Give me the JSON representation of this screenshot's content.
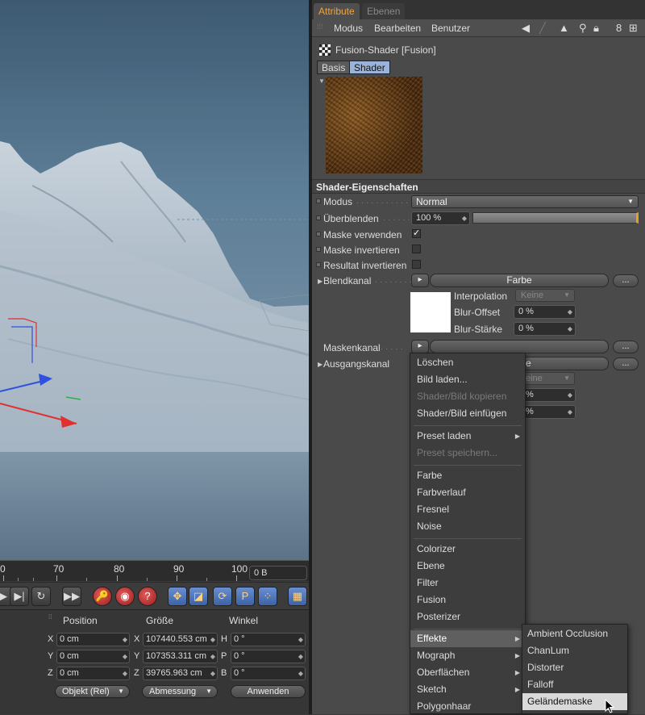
{
  "viewport": {
    "timeline_ticks": [
      "0",
      "70",
      "80",
      "90",
      "100"
    ],
    "frame_field": "0 B"
  },
  "coords": {
    "headers": [
      "Position",
      "Größe",
      "Winkel"
    ],
    "position": [
      {
        "axis": "X",
        "value": "0 cm"
      },
      {
        "axis": "Y",
        "value": "0 cm"
      },
      {
        "axis": "Z",
        "value": "0 cm"
      }
    ],
    "size": [
      {
        "axis": "X",
        "value": "107440.553 cm"
      },
      {
        "axis": "Y",
        "value": "107353.311 cm"
      },
      {
        "axis": "Z",
        "value": "39765.963 cm"
      }
    ],
    "angle": [
      {
        "axis": "H",
        "value": "0 °"
      },
      {
        "axis": "P",
        "value": "0 °"
      },
      {
        "axis": "B",
        "value": "0 °"
      }
    ],
    "mode_dropdown": "Objekt (Rel)",
    "size_dropdown": "Abmessung",
    "apply_button": "Anwenden"
  },
  "attr": {
    "tabs": [
      "Attribute",
      "Ebenen"
    ],
    "menu": [
      "Modus",
      "Bearbeiten",
      "Benutzer"
    ],
    "object_title": "Fusion-Shader [Fusion]",
    "subtabs": [
      "Basis",
      "Shader"
    ],
    "section_title": "Shader-Eigenschaften",
    "props": {
      "modus_label": "Modus",
      "modus_value": "Normal",
      "ueberblenden_label": "Überblenden",
      "ueberblenden_value": "100 %",
      "ueberblenden_fraction": 1.0,
      "maske_verwenden_label": "Maske verwenden",
      "maske_verwenden_checked": "✓",
      "maske_invertieren_label": "Maske invertieren",
      "resultat_invertieren_label": "Resultat invertieren",
      "blendkanal_label": "Blendkanal",
      "blendkanal_button": "Farbe",
      "interpolation_label": "Interpolation",
      "interpolation_value": "Keine",
      "blur_offset_label": "Blur-Offset",
      "blur_offset_value": "0 %",
      "blur_staerke_label": "Blur-Stärke",
      "blur_staerke_value": "0 %",
      "maskenkanal_label": "Maskenkanal",
      "ausgangskanal_label": "Ausgangskanal",
      "ausgangskanal_partial": "e",
      "interpolation2_partial": "eine",
      "percent_partial": "%",
      "dots": "..."
    }
  },
  "context_menu": {
    "items": [
      {
        "label": "Löschen",
        "disabled": false,
        "submenu": false
      },
      {
        "label": "Bild laden...",
        "disabled": false,
        "submenu": false
      },
      {
        "label": "Shader/Bild kopieren",
        "disabled": true,
        "submenu": false
      },
      {
        "label": "Shader/Bild einfügen",
        "disabled": false,
        "submenu": false
      },
      {
        "label": "Preset laden",
        "disabled": false,
        "submenu": true
      },
      {
        "label": "Preset speichern...",
        "disabled": true,
        "submenu": false
      },
      {
        "label": "Farbe",
        "disabled": false,
        "submenu": false
      },
      {
        "label": "Farbverlauf",
        "disabled": false,
        "submenu": false
      },
      {
        "label": "Fresnel",
        "disabled": false,
        "submenu": false
      },
      {
        "label": "Noise",
        "disabled": false,
        "submenu": false
      },
      {
        "label": "Colorizer",
        "disabled": false,
        "submenu": false
      },
      {
        "label": "Ebene",
        "disabled": false,
        "submenu": false
      },
      {
        "label": "Filter",
        "disabled": false,
        "submenu": false
      },
      {
        "label": "Fusion",
        "disabled": false,
        "submenu": false
      },
      {
        "label": "Posterizer",
        "disabled": false,
        "submenu": false
      },
      {
        "label": "Effekte",
        "disabled": false,
        "submenu": true,
        "highlighted": true
      },
      {
        "label": "Mograph",
        "disabled": false,
        "submenu": true
      },
      {
        "label": "Oberflächen",
        "disabled": false,
        "submenu": true
      },
      {
        "label": "Sketch",
        "disabled": false,
        "submenu": true
      },
      {
        "label": "Polygonhaar",
        "disabled": false,
        "submenu": false
      }
    ],
    "submenu_items": [
      "Ambient Occlusion",
      "ChanLum",
      "Distorter",
      "Falloff",
      "Geländemaske"
    ],
    "submenu_selected": "Geländemaske"
  },
  "colors": {
    "accent_orange": "#f2a33a",
    "panel_bg": "#4a4a4a",
    "selected_tab": "#9bb3d8"
  }
}
